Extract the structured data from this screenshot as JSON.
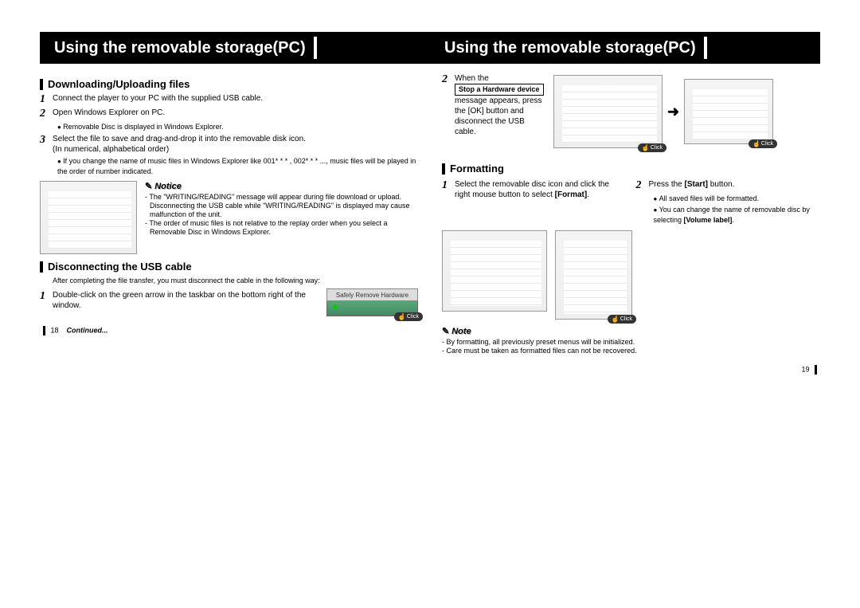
{
  "bar": {
    "left_title": "Using the removable storage(PC)",
    "right_title": "Using the removable storage(PC)"
  },
  "left": {
    "h1": "Downloading/Uploading files",
    "s1": "Connect the player to your PC with the supplied USB cable.",
    "s2": "Open Windows Explorer on PC.",
    "s2_bul": "Removable Disc is displayed in Windows Explorer.",
    "s3_a": "Select the file to save and drag-and-drop it into the removable disk icon.",
    "s3_b": "(In numerical, alphabetical order)",
    "s3_bul": "If you change the name of music files in Windows Explorer like 001* * * , 002* * * ..., music files will be played in the order of number indicated.",
    "notice_label": "Notice",
    "notice_1": "- The \"WRITING/READING\" message will appear during file download or upload. Disconnecting the USB cable while \"WRITING/READING\" is displayed may cause malfunction of the unit.",
    "notice_2": "- The order of music files is not relative to the replay order when you select a Removable Disc in Windows Explorer.",
    "h2": "Disconnecting the USB cable",
    "intro": "After completing the file transfer, you must disconnect the cable in the following way:",
    "d1": "Double-click on the green arrow in the taskbar on the bottom right of the window.",
    "safely_label": "Safely Remove Hardware",
    "click": "Click",
    "page_left": "18",
    "continued": "Continued..."
  },
  "right": {
    "d2_a": "When the",
    "d2_box": "Stop a Hardware device",
    "d2_b": "message appears, press the [OK] button and disconnect the USB cable.",
    "click": "Click",
    "h1": "Formatting",
    "f1_a": "Select the removable disc icon and click the right mouse button to select [Format].",
    "f2_a": "Press the [Start] button.",
    "f2_bul1": "All saved files will be formatted.",
    "f2_bul2": "You can change the name of removable disc by selecting [Volume label].",
    "note_label": "Note",
    "note_1": "- By formatting, all previously preset menus will be initialized.",
    "note_2": "- Care must be taken as formatted files can not be recovered.",
    "page_right": "19"
  }
}
